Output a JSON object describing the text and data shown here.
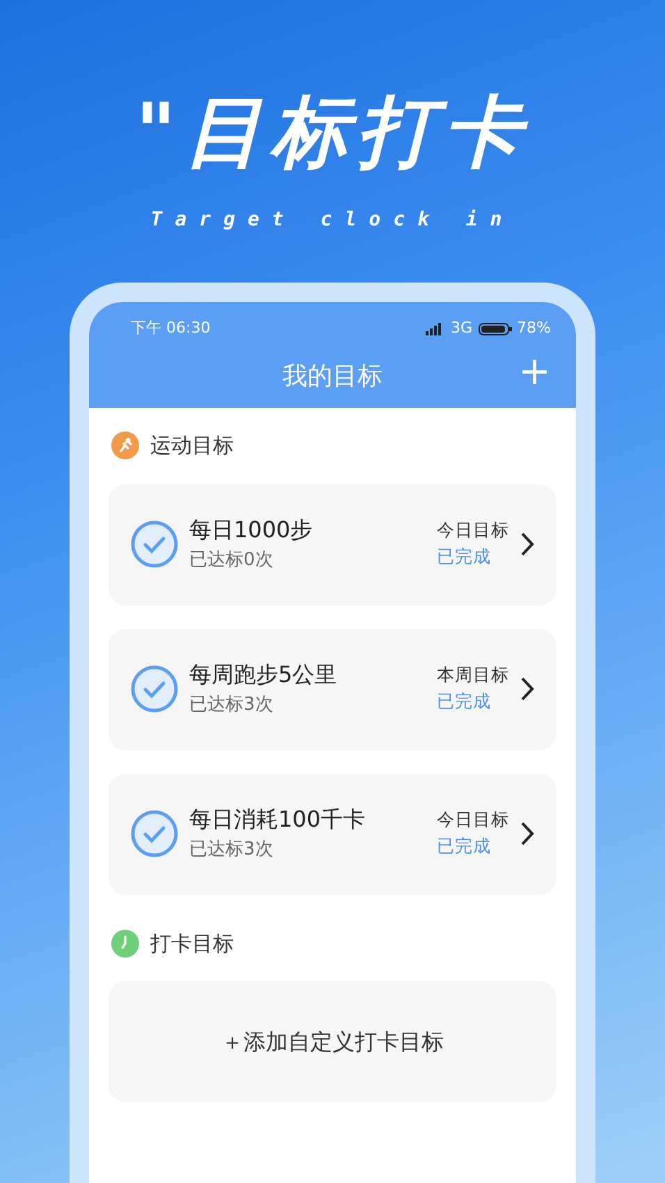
{
  "promo": {
    "headline": "\"目标打卡",
    "subtitle": "Target clock in"
  },
  "status_bar": {
    "time": "下午 06:30",
    "network": "3G",
    "battery": "78%"
  },
  "header": {
    "title": "我的目标",
    "add_button": "+"
  },
  "sections": [
    {
      "title": "运动目标",
      "kind": "sport",
      "goals": [
        {
          "name": "每日1000步",
          "achieved": "已达标0次",
          "period": "今日目标",
          "status": "已完成"
        },
        {
          "name": "每周跑步5公里",
          "achieved": "已达标3次",
          "period": "本周目标",
          "status": "已完成"
        },
        {
          "name": "每日消耗100千卡",
          "achieved": "已达标3次",
          "period": "今日目标",
          "status": "已完成"
        }
      ]
    },
    {
      "title": "打卡目标",
      "kind": "clock",
      "add_label": "＋添加自定义打卡目标"
    }
  ]
}
